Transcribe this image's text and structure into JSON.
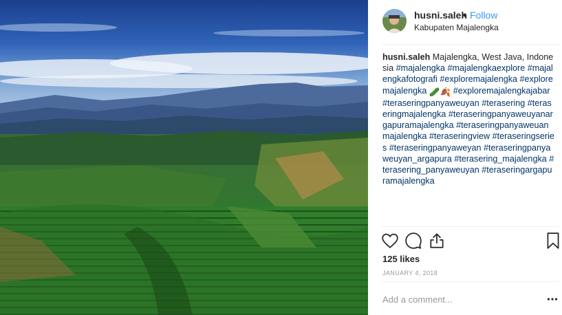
{
  "post": {
    "photo_icon": "landscape-photo",
    "author": "husni.saleh",
    "separator": "•",
    "follow_label": "Follow",
    "location": "Kabupaten Majalengka",
    "caption_user": "husni.saleh",
    "caption_text": " Majalengka, West Java, Indonesia ",
    "caption_tags_1": [
      "#majalengka",
      "#majalengkaexplore",
      "#majalengkafotografi",
      "#exploremajalengka",
      "#exploremajalengka"
    ],
    "caption_emoji": "🥒🍂",
    "caption_tags_2": [
      "#exploremajalengkajabar",
      "#teraseringpanyaweuyan",
      "#terasering",
      "#teraseringmajalengka",
      "#teraseringpanyaweuyanargapuramajalengka",
      "#teraseringpanyaweuanmajalengka",
      "#teraseringview",
      "#teraseringseries",
      "#teraseringpanyaweyan",
      "#teraseringpanyaweuyan_argapura",
      "#terasering_majalengka",
      "#terasering_panyaweuyan",
      "#teraseringargapuramajalengka"
    ],
    "likes": "125 likes",
    "date": "JANUARY 4, 2018",
    "comment_placeholder": "Add a comment...",
    "icons": {
      "like": "heart-icon",
      "comment": "comment-bubble-icon",
      "share": "share-icon",
      "save": "bookmark-icon",
      "more": "more-options-icon"
    },
    "colors": {
      "link": "#3897f0",
      "hashtag": "#003569",
      "muted": "#999999",
      "text": "#262626"
    }
  }
}
